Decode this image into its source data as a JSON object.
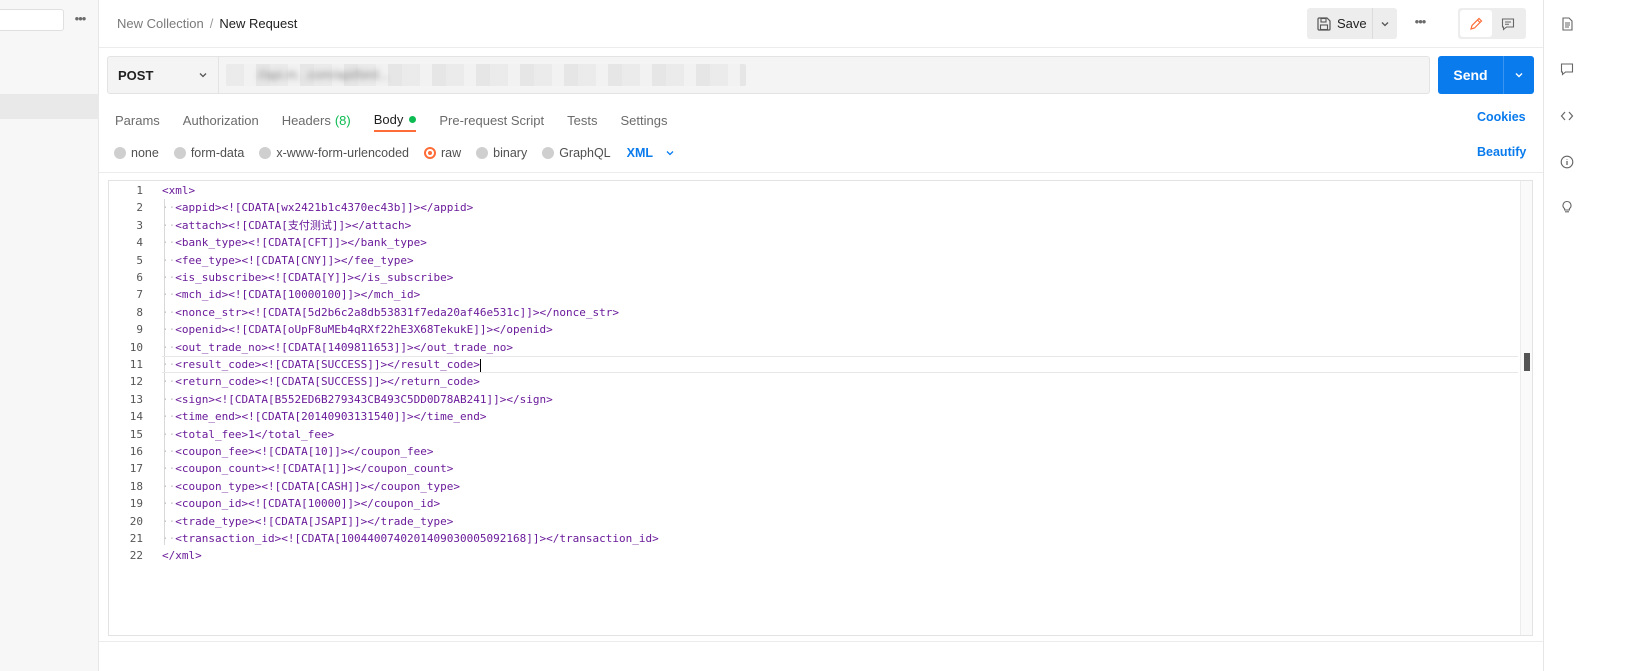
{
  "breadcrumb": {
    "parent": "New Collection",
    "separator": "/",
    "current": "New Request"
  },
  "header": {
    "save_label": "Save",
    "more_label": "•••"
  },
  "sidebar": {
    "more_label": "•••"
  },
  "request": {
    "method": "POST",
    "url": "//api.m.              .com/api/bird...",
    "send_label": "Send"
  },
  "tabs": [
    {
      "label": "Params"
    },
    {
      "label": "Authorization"
    },
    {
      "label": "Headers",
      "count": "(8)"
    },
    {
      "label": "Body"
    },
    {
      "label": "Pre-request Script"
    },
    {
      "label": "Tests"
    },
    {
      "label": "Settings"
    }
  ],
  "cookies_label": "Cookies",
  "body_types": [
    {
      "label": "none"
    },
    {
      "label": "form-data"
    },
    {
      "label": "x-www-form-urlencoded"
    },
    {
      "label": "raw",
      "selected": true
    },
    {
      "label": "binary"
    },
    {
      "label": "GraphQL"
    }
  ],
  "language": "XML",
  "beautify_label": "Beautify",
  "editor": {
    "line_numbers": [
      "1",
      "2",
      "3",
      "4",
      "5",
      "6",
      "7",
      "8",
      "9",
      "10",
      "11",
      "12",
      "13",
      "14",
      "15",
      "16",
      "17",
      "18",
      "19",
      "20",
      "21",
      "22"
    ],
    "lines": [
      "<xml>",
      "<appid><![CDATA[wx2421b1c4370ec43b]]></appid>",
      "<attach><![CDATA[支付测试]]></attach>",
      "<bank_type><![CDATA[CFT]]></bank_type>",
      "<fee_type><![CDATA[CNY]]></fee_type>",
      "<is_subscribe><![CDATA[Y]]></is_subscribe>",
      "<mch_id><![CDATA[10000100]]></mch_id>",
      "<nonce_str><![CDATA[5d2b6c2a8db53831f7eda20af46e531c]]></nonce_str>",
      "<openid><![CDATA[oUpF8uMEb4qRXf22hE3X68TekukE]]></openid>",
      "<out_trade_no><![CDATA[1409811653]]></out_trade_no>",
      "<result_code><![CDATA[SUCCESS]]></result_code>",
      "<return_code><![CDATA[SUCCESS]]></return_code>",
      "<sign><![CDATA[B552ED6B279343CB493C5DD0D78AB241]]></sign>",
      "<time_end><![CDATA[20140903131540]]></time_end>",
      "<total_fee>1</total_fee>",
      "<coupon_fee><![CDATA[10]]></coupon_fee>",
      "<coupon_count><![CDATA[1]]></coupon_count>",
      "<coupon_type><![CDATA[CASH]]></coupon_type>",
      "<coupon_id><![CDATA[10000]]></coupon_id>",
      "<trade_type><![CDATA[JSAPI]]></trade_type>",
      "<transaction_id><![CDATA[1004400740201409030005092168]]></transaction_id>",
      "</xml>"
    ],
    "current_line": "11"
  },
  "colors": {
    "accent": "#ff6c37",
    "primary": "#097bed",
    "success": "#0cbb52"
  }
}
